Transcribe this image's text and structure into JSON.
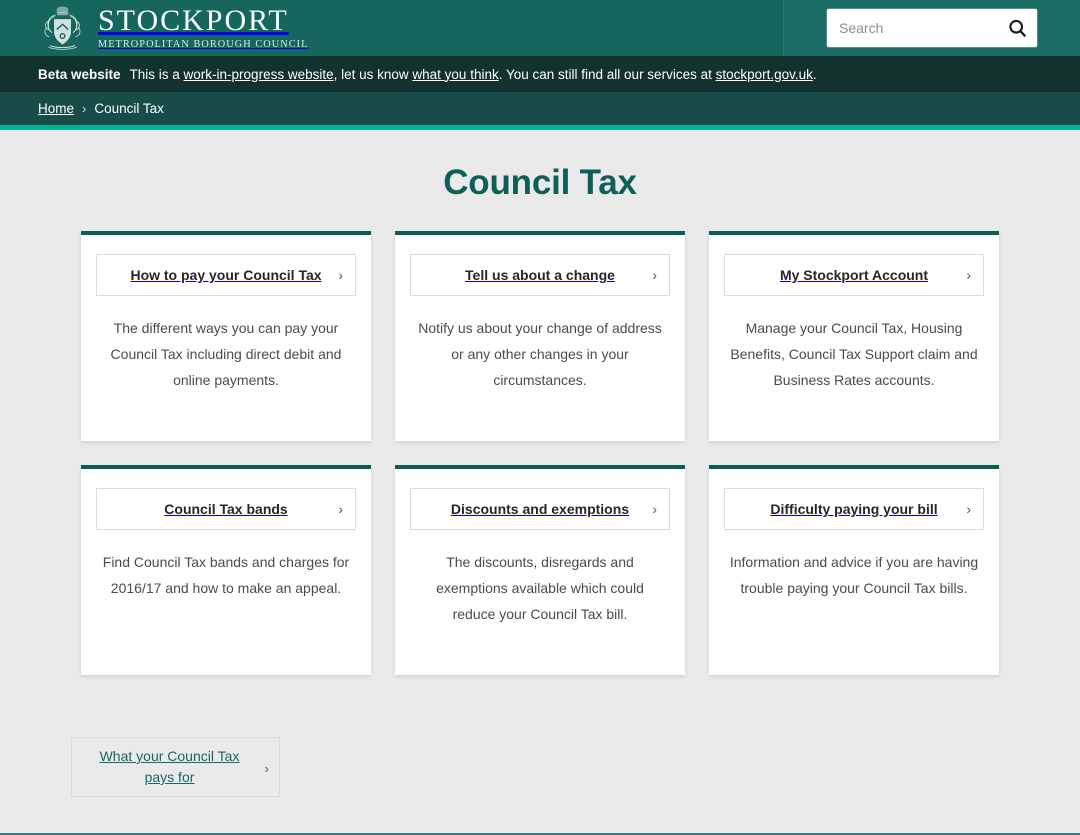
{
  "header": {
    "brand_name": "STOCKPORT",
    "brand_sub": "METROPOLITAN BOROUGH COUNCIL",
    "crest_icon": "coat-of-arms-crest-icon",
    "search": {
      "placeholder": "Search",
      "value": "",
      "icon": "search-icon"
    },
    "colors": {
      "header_bg": "#16665d",
      "search_panel_bg": "#1a6e65"
    }
  },
  "beta_banner": {
    "label": "Beta website",
    "text_1": "This is a ",
    "link_1": "work-in-progress website",
    "text_2": ", let us know ",
    "link_2": "what you think",
    "text_3": ". You can still find all our services at ",
    "link_3": "stockport.gov.uk",
    "text_4": ".",
    "bg": "#12322e"
  },
  "breadcrumb": {
    "home": "Home",
    "separator": "›",
    "current": "Council Tax",
    "bg": "#184c48",
    "accent": "#00b39b"
  },
  "main": {
    "title": "Council Tax",
    "title_color": "#0d5f57",
    "page_bg": "#eaeaea",
    "card_top_border": "#0b5c54",
    "chevron": "›",
    "cards": [
      {
        "label": "How to pay your Council Tax",
        "description": "The different ways you can pay your Council Tax including direct debit and online payments."
      },
      {
        "label": "Tell us about a change",
        "description": "Notify us about your change of address or any other changes in your circumstances."
      },
      {
        "label": "My Stockport Account",
        "description": "Manage your Council Tax, Housing Benefits, Council Tax Support claim and Business Rates accounts."
      },
      {
        "label": "Council Tax bands",
        "description": "Find Council Tax bands and charges for 2016/17 and how to make an appeal."
      },
      {
        "label": "Discounts and exemptions",
        "description": "The discounts, disregards and exemptions available which could reduce your Council Tax bill."
      },
      {
        "label": "Difficulty paying your bill",
        "description": "Information and advice if you are having trouble paying your Council Tax bills."
      }
    ],
    "footer_link": {
      "label": "What your Council Tax pays for",
      "chevron": "›",
      "color": "#14695f"
    }
  }
}
